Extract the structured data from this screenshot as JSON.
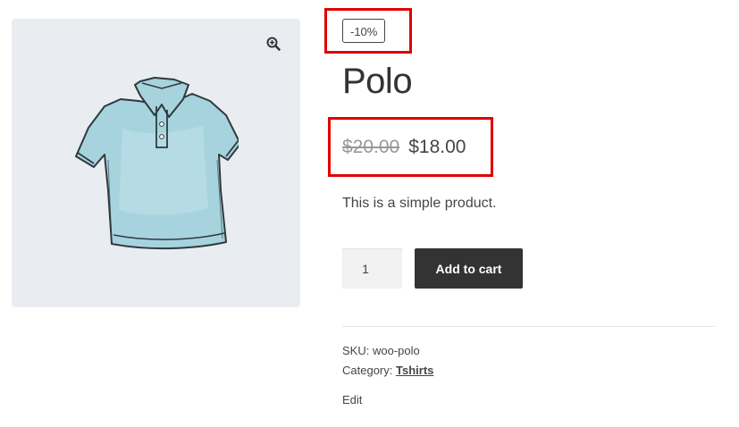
{
  "product": {
    "sale_badge": "-10%",
    "title": "Polo",
    "price_regular": "$20.00",
    "price_sale": "$18.00",
    "short_description": "This is a simple product.",
    "quantity_value": "1",
    "add_to_cart_label": "Add to cart",
    "sku_label": "SKU:",
    "sku_value": "woo-polo",
    "category_label": "Category:",
    "category_value": "Tshirts",
    "edit_label": "Edit"
  },
  "gallery": {
    "zoom_icon": "magnifier-plus-icon",
    "image_subject": "polo-shirt"
  },
  "colors": {
    "highlight": "#e00000",
    "button_bg": "#333333",
    "gallery_bg": "#e9edf1",
    "shirt": "#9fd0dc"
  }
}
